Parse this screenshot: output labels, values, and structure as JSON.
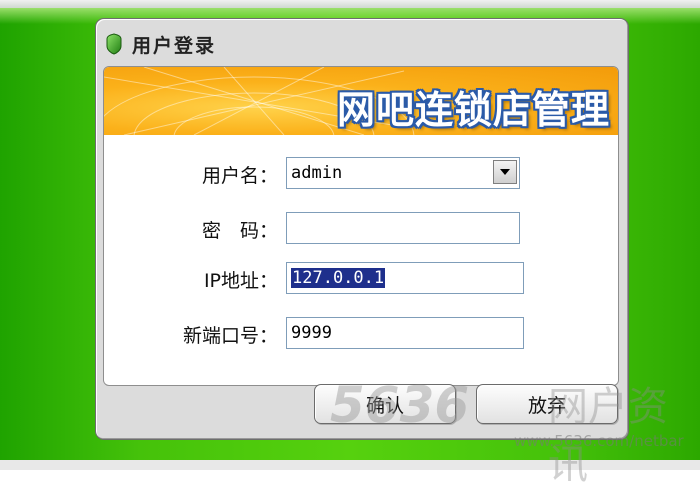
{
  "window": {
    "title": "用户登录"
  },
  "banner": {
    "title": "网吧连锁店管理"
  },
  "form": {
    "username_label": "用户名：",
    "username_value": "admin",
    "password_label": "密　码：",
    "password_value": "",
    "ip_label": "IP地址：",
    "ip_value": "127.0.0.1",
    "port_label": "新端口号：",
    "port_value": "9999"
  },
  "buttons": {
    "confirm": "确认",
    "cancel": "放弃"
  },
  "watermark": {
    "logo": "5636",
    "text": "网户资讯",
    "url": "www.5636.com/netbar"
  },
  "colors": {
    "background_green": "#45c20a",
    "banner_orange": "#fbb11a",
    "banner_text_outline": "#2a5aa8",
    "selection": "#1e2f8c"
  }
}
